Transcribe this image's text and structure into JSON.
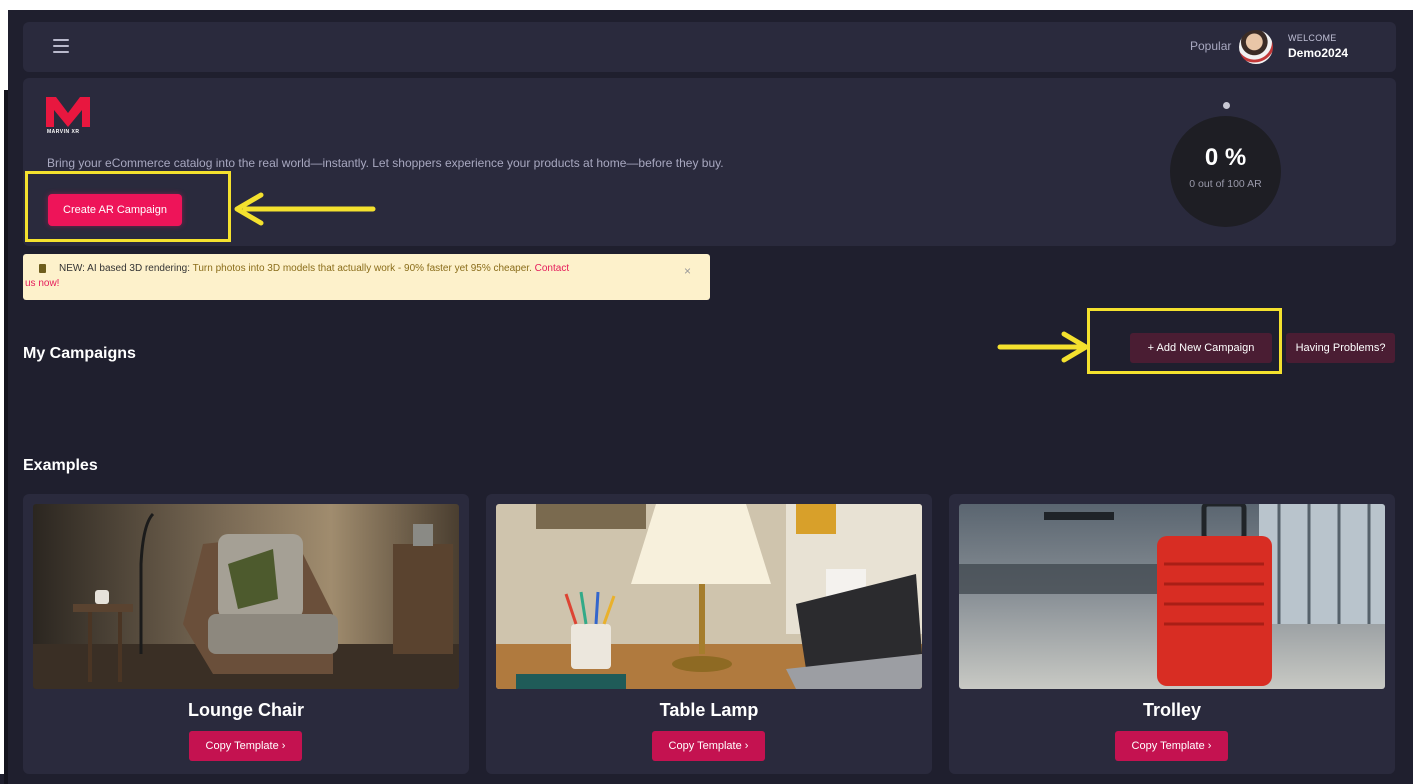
{
  "header": {
    "popular_label": "Popular",
    "welcome_label": "WELCOME",
    "username": "Demo2024"
  },
  "hero": {
    "logo_text": "MARVIN XR",
    "tagline": "Bring your eCommerce catalog into the real world—instantly.  Let shoppers experience your products at home—before they buy.",
    "cta_label": "Create AR Campaign",
    "progress_percent": "0 %",
    "progress_sub": "0 out of 100 AR"
  },
  "notice": {
    "prefix": "NEW: AI based 3D rendering:",
    "message": "Turn photos into 3D models that actually work - 90% faster yet 95% cheaper.",
    "contact_part1": "Contact",
    "contact_part2": "us now!",
    "close": "×"
  },
  "campaigns": {
    "heading": "My Campaigns",
    "add_label": "+ Add New Campaign",
    "help_label": "Having Problems?"
  },
  "examples": {
    "heading": "Examples",
    "cards": [
      {
        "title": "Lounge Chair",
        "button": "Copy Template ›"
      },
      {
        "title": "Table Lamp",
        "button": "Copy Template ›"
      },
      {
        "title": "Trolley",
        "button": "Copy Template ›"
      }
    ]
  },
  "colors": {
    "background": "#1f1f2e",
    "panel": "#2a2a3d",
    "accent": "#ee1459",
    "highlight": "#f4e12e"
  }
}
